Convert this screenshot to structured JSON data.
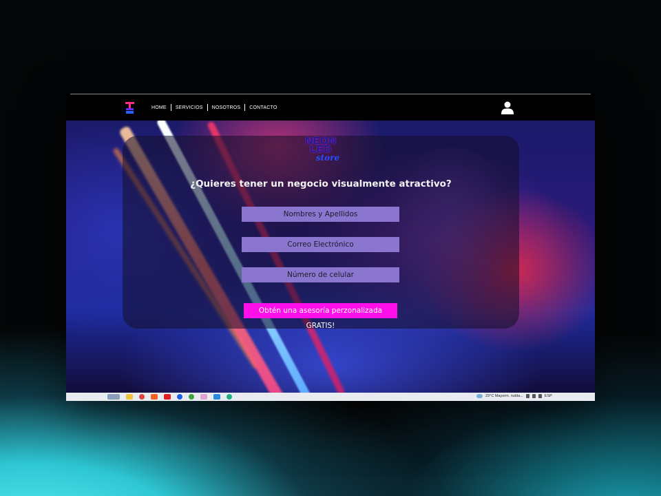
{
  "navbar": {
    "links": [
      "HOME",
      "SERVICIOS",
      "NOSOTROS",
      "CONTACTO"
    ]
  },
  "brand": {
    "line1": "NEON",
    "line2": "LED",
    "line3": "store"
  },
  "form": {
    "headline": "¿Quieres tener un negocio visualmente atractivo?",
    "name_placeholder": "Nombres y Apellidos",
    "email_placeholder": "Correo Electrónico",
    "phone_placeholder": "Número de celular",
    "cta_label": "Obtén una asesoría perzonalizada GRATIS!"
  },
  "taskbar": {
    "weather_text": "23°C  Mayorm. nubla...",
    "lang": "ESP"
  },
  "colors": {
    "field_bg": "#8b76cf",
    "cta_bg": "#ff10ea",
    "navbar_bg": "#000000"
  },
  "icons": [
    "neon-logo-icon",
    "user-icon",
    "search-icon",
    "chrome-icon",
    "brave-icon",
    "youtube-icon",
    "facebook-icon",
    "vscode-icon",
    "edge-icon",
    "cloud-icon"
  ]
}
